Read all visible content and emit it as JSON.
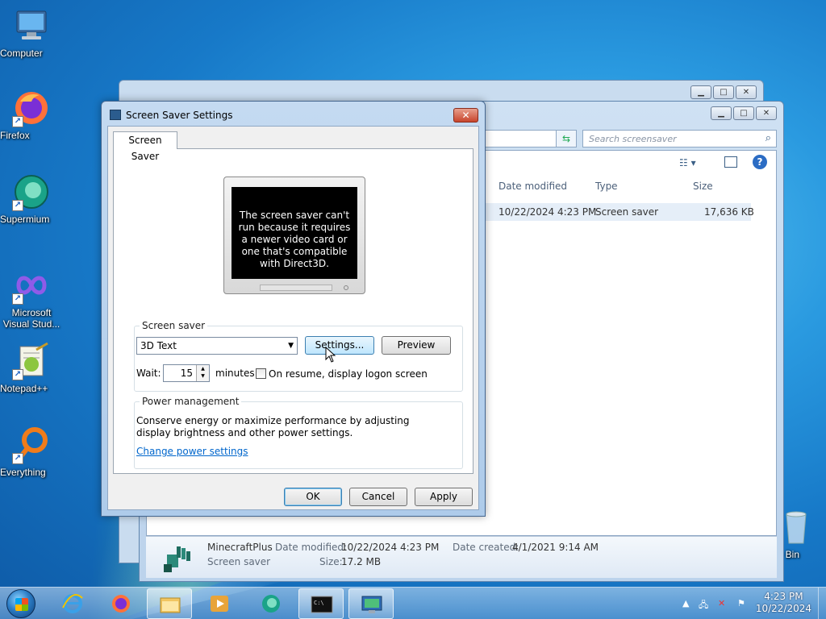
{
  "desktop": {
    "icons": [
      {
        "label": "Computer"
      },
      {
        "label": "Firefox"
      },
      {
        "label": "Supermium"
      },
      {
        "label": "Microsoft Visual Stud..."
      },
      {
        "label": "Notepad++"
      },
      {
        "label": "Everything"
      },
      {
        "label": "cle Bin"
      }
    ]
  },
  "explorer": {
    "search_placeholder": "Search screensaver",
    "columns": [
      "Date modified",
      "Type",
      "Size"
    ],
    "row": {
      "date_modified": "10/22/2024 4:23 PM",
      "type": "Screen saver",
      "size": "17,636 KB"
    },
    "details": {
      "name": "MinecraftPlus",
      "kind": "Screen saver",
      "date_modified_label": "Date modified:",
      "date_modified": "10/22/2024 4:23 PM",
      "size_label": "Size:",
      "size": "17.2 MB",
      "date_created_label": "Date created:",
      "date_created": "4/1/2021 9:14 AM"
    }
  },
  "dialog": {
    "title": "Screen Saver Settings",
    "close_label": "✕",
    "tab_label": "Screen Saver",
    "preview_message": "The screen saver can't run because it requires a newer video card or one that's compatible with Direct3D.",
    "screensaver_group_title": "Screen saver",
    "selected_screensaver": "3D Text",
    "settings_button": "Settings...",
    "preview_button": "Preview",
    "wait_label": "Wait:",
    "wait_value": "15",
    "minutes_label": "minutes",
    "on_resume_label": "On resume, display logon screen",
    "power_group_title": "Power management",
    "power_description": "Conserve energy or maximize performance by adjusting display brightness and other power settings.",
    "power_link": "Change power settings",
    "ok_button": "OK",
    "cancel_button": "Cancel",
    "apply_button": "Apply"
  },
  "taskbar": {
    "time": "4:23 PM",
    "date": "10/22/2024"
  }
}
